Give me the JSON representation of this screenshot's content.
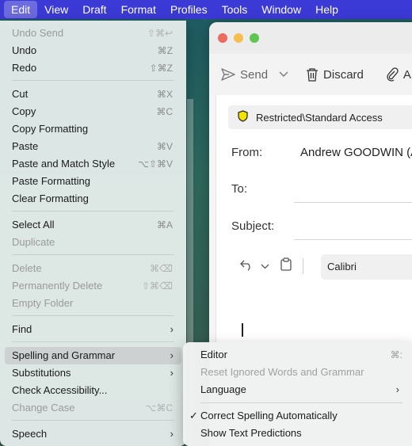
{
  "menubar": {
    "items": [
      "Edit",
      "View",
      "Draft",
      "Format",
      "Profiles",
      "Tools",
      "Window",
      "Help"
    ],
    "active": "Edit"
  },
  "window": {
    "toolbar": {
      "send_label": "Send",
      "discard_label": "Discard",
      "attach_label": "A"
    },
    "sensitivity_label": "Restricted\\Standard Access",
    "from_label": "From:",
    "from_value": "Andrew GOODWIN (A",
    "to_label": "To:",
    "subject_label": "Subject:",
    "font_name": "Calibri"
  },
  "edit_menu": {
    "items": [
      {
        "label": "Undo Send",
        "shortcut": "⇧⌘↩",
        "disabled": true
      },
      {
        "label": "Undo",
        "shortcut": "⌘Z"
      },
      {
        "label": "Redo",
        "shortcut": "⇧⌘Z"
      },
      {
        "label": "Cut",
        "shortcut": "⌘X"
      },
      {
        "label": "Copy",
        "shortcut": "⌘C"
      },
      {
        "label": "Copy Formatting",
        "shortcut": ""
      },
      {
        "label": "Paste",
        "shortcut": "⌘V"
      },
      {
        "label": "Paste and Match Style",
        "shortcut": "⌥⇧⌘V"
      },
      {
        "label": "Paste Formatting",
        "shortcut": ""
      },
      {
        "label": "Clear Formatting",
        "shortcut": ""
      },
      {
        "label": "Select All",
        "shortcut": "⌘A"
      },
      {
        "label": "Duplicate",
        "shortcut": "",
        "disabled": true
      },
      {
        "label": "Delete",
        "shortcut": "⌘⌫",
        "disabled": true
      },
      {
        "label": "Permanently Delete",
        "shortcut": "⇧⌘⌫",
        "disabled": true
      },
      {
        "label": "Empty Folder",
        "shortcut": "",
        "disabled": true
      },
      {
        "label": "Find",
        "submenu": true
      },
      {
        "label": "Spelling and Grammar",
        "submenu": true,
        "highlighted": true
      },
      {
        "label": "Substitutions",
        "submenu": true
      },
      {
        "label": "Check Accessibility...",
        "shortcut": ""
      },
      {
        "label": "Change Case",
        "shortcut": "⌥⌘C",
        "disabled": true
      },
      {
        "label": "Speech",
        "submenu": true
      }
    ]
  },
  "spelling_submenu": {
    "items": [
      {
        "label": "Editor",
        "shortcut": "⌘:"
      },
      {
        "label": "Reset Ignored Words and Grammar",
        "disabled": true
      },
      {
        "label": "Language",
        "submenu": true
      },
      {
        "label": "Correct Spelling Automatically",
        "checked": true
      },
      {
        "label": "Show Text Predictions"
      }
    ]
  }
}
